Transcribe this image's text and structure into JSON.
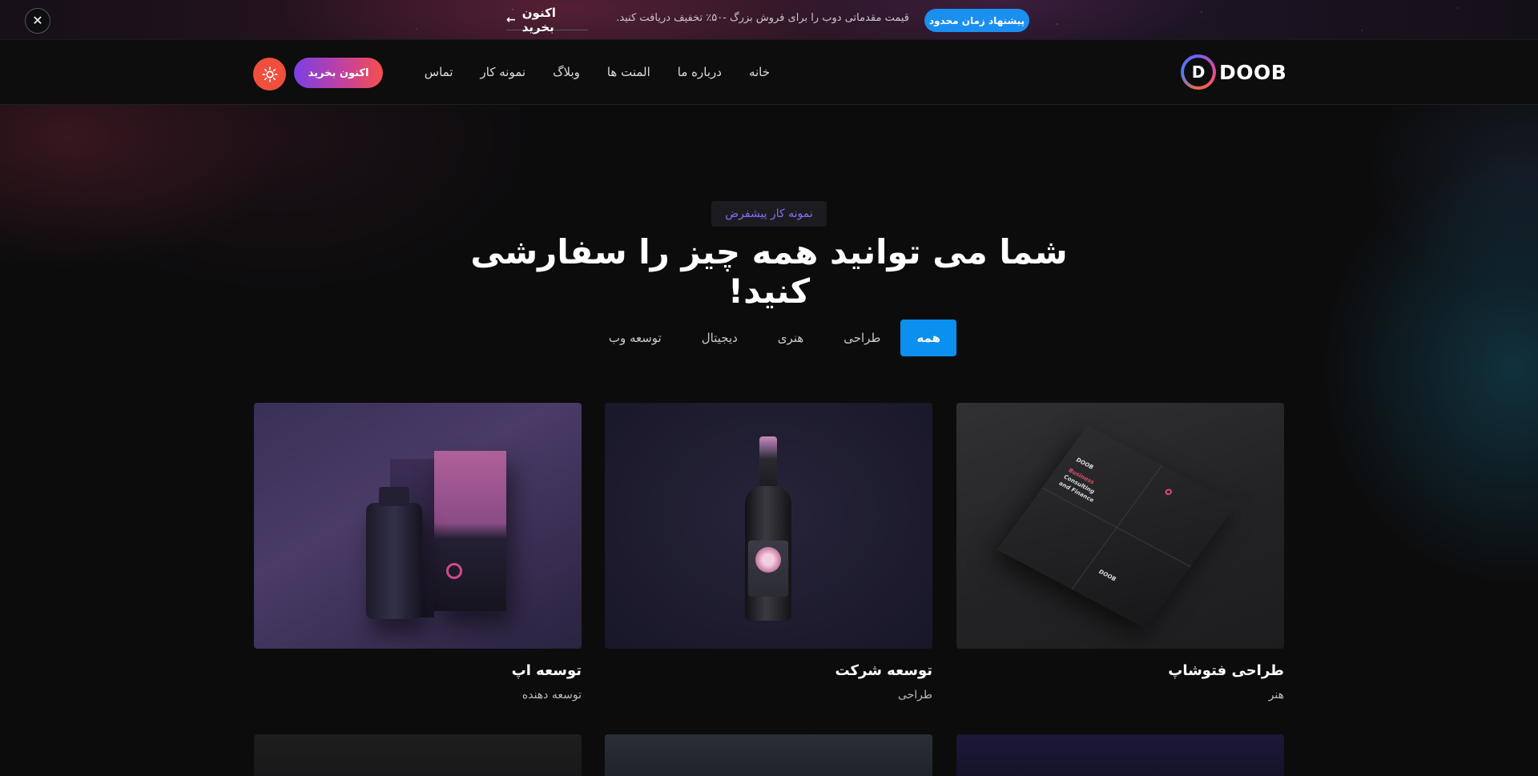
{
  "banner": {
    "close_label": "✕",
    "cta_label": "اکنون بخرید",
    "cta_arrow": "←",
    "text": "قیمت مقدماتی دوب را برای فروش بزرگ -۵۰٪ تخفیف دریافت کنید.",
    "offer_label": "پیشنهاد زمان محدود"
  },
  "header": {
    "logo_letter": "D",
    "logo_text": "DOOB",
    "nav": [
      "خانه",
      "درباره ما",
      "المنت ها",
      "وبلاگ",
      "نمونه کار",
      "تماس"
    ],
    "buy_label": "اکنون بخرید",
    "theme_icon": "sun-icon"
  },
  "hero": {
    "badge": "نمونه کار پیشفرض",
    "title": "شما می توانید همه چیز را سفارشی کنید!"
  },
  "filters": {
    "items": [
      "همه",
      "طراحی",
      "هنری",
      "دیجیتال",
      "توسعه وب"
    ],
    "active": "همه"
  },
  "cards": [
    {
      "title": "طراحی فتوشاپ",
      "subtitle": "هنر",
      "image": "brochure-mockup"
    },
    {
      "title": "توسعه شرکت",
      "subtitle": "طراحی",
      "image": "wine-bottle-mockup"
    },
    {
      "title": "توسعه اپ",
      "subtitle": "توسعه دهنده",
      "image": "packaging-mockup"
    }
  ],
  "colors": {
    "accent_blue": "#0b90f0",
    "buy_gradient_start": "#7b3fe4",
    "buy_gradient_end": "#f6504a",
    "theme_button": "#f04f3e",
    "badge_text": "#8a6cf5"
  }
}
